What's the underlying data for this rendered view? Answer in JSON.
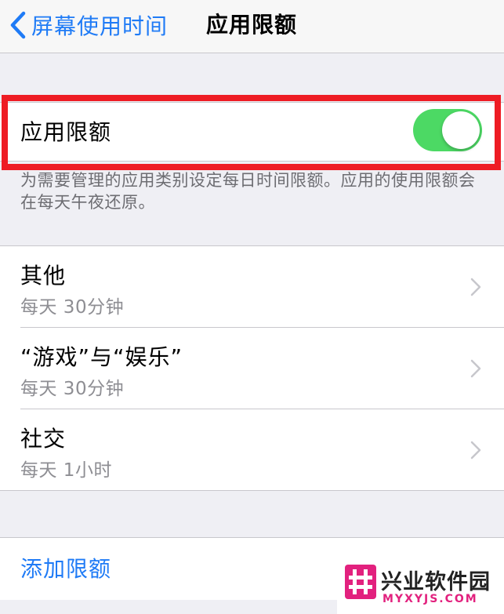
{
  "nav": {
    "back_label": "屏幕使用时间",
    "title": "应用限额"
  },
  "app_limits": {
    "toggle_label": "应用限额",
    "enabled": true,
    "footer": "为需要管理的应用类别设定每日时间限额。应用的使用限额会在每天午夜还原。"
  },
  "limits": [
    {
      "title": "其他",
      "subtitle": "每天 30分钟"
    },
    {
      "title": "“游戏”与“娱乐”",
      "subtitle": "每天 30分钟"
    },
    {
      "title": "社交",
      "subtitle": "每天 1小时"
    }
  ],
  "add_limit_label": "添加限额",
  "watermark": {
    "title": "兴业软件园",
    "url": "MYXYJS.COM"
  },
  "colors": {
    "accent": "#1f7bf6",
    "switch_on": "#4cd964",
    "highlight": "#ee1c24",
    "watermark": "#e2217e"
  }
}
